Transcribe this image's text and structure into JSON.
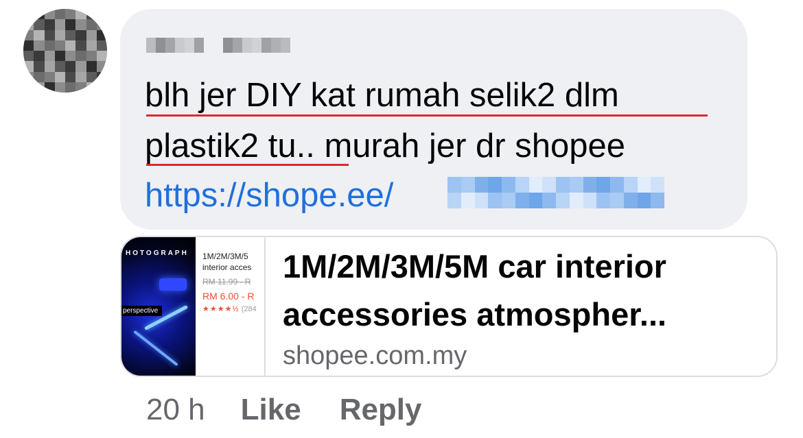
{
  "comment": {
    "author_name": "",
    "message_line1": "blh jer DIY kat rumah selik2 dlm",
    "message_line2": "plastik2 tu.. murah jer dr shopee",
    "link_prefix": "https://shope.ee/"
  },
  "link_preview": {
    "thumbnail": {
      "photo_label": "HOTOGRAPH",
      "perspective_label": "perspective",
      "product_title": "1M/2M/3M/5",
      "product_subtitle": "interior acces",
      "original_price": "RM 11.99 - R",
      "sale_price": "RM 6.00 - R",
      "stars": "★★★★½",
      "rating_count": "(284"
    },
    "title": "1M/2M/3M/5M car interior accessories atmospher...",
    "domain": "shopee.com.my"
  },
  "actions": {
    "time": "20 h",
    "like_label": "Like",
    "reply_label": "Reply"
  },
  "colors": {
    "bubble_bg": "#eef0f4",
    "link": "#216fdb",
    "spellcheck_underline": "#e0262e",
    "secondary_text": "#65676b",
    "shopee_orange": "#ee4d2d"
  }
}
